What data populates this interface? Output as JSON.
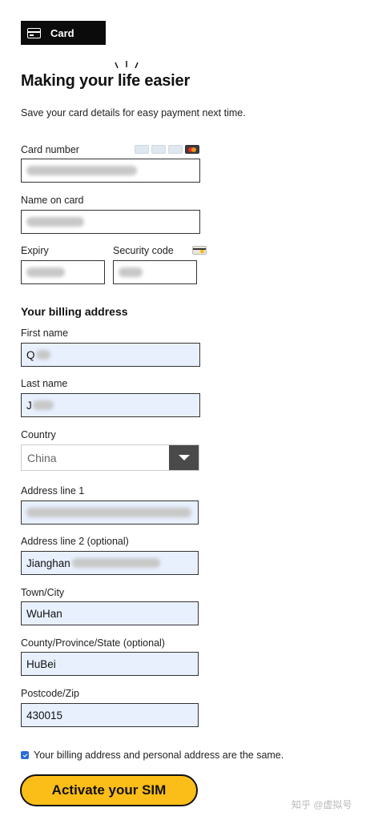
{
  "tab": {
    "label": "Card"
  },
  "header": {
    "title": "Making your life easier",
    "subtitle": "Save your card details for easy payment next time."
  },
  "card": {
    "number_label": "Card number",
    "name_label": "Name on card",
    "expiry_label": "Expiry",
    "security_label": "Security code"
  },
  "billing": {
    "section_title": "Your billing address",
    "first_name_label": "First name",
    "first_name_value": "Q",
    "last_name_label": "Last name",
    "last_name_value": "J",
    "country_label": "Country",
    "country_value": "China",
    "address1_label": "Address line 1",
    "address2_label": "Address line 2 (optional)",
    "address2_value": "Jianghan",
    "town_label": "Town/City",
    "town_value": "WuHan",
    "county_label": "County/Province/State (optional)",
    "county_value": "HuBei",
    "postcode_label": "Postcode/Zip",
    "postcode_value": "430015"
  },
  "same_address": {
    "checked": true,
    "label": "Your billing address and personal address are the same."
  },
  "cta": {
    "label": "Activate your SIM"
  },
  "watermark": {
    "text": "知乎 @虚拟号"
  },
  "colors": {
    "accent": "#fbbd18",
    "autofill": "#e8f0fe",
    "dark": "#0b0b0b"
  }
}
